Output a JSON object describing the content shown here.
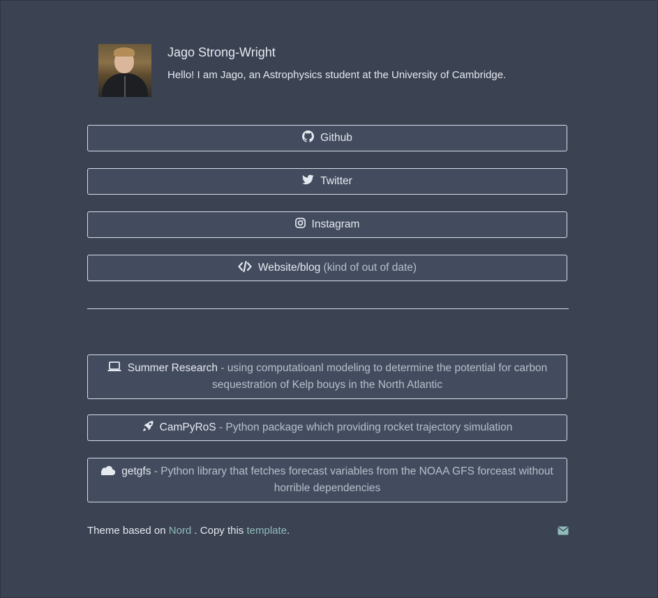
{
  "profile": {
    "name": "Jago Strong-Wright",
    "bio": "Hello! I am Jago, an Astrophysics student at the University of Cambridge.",
    "avatar_icon": "profile-photo"
  },
  "links": [
    {
      "icon": "github-icon",
      "label": "Github",
      "note": ""
    },
    {
      "icon": "twitter-icon",
      "label": "Twitter",
      "note": ""
    },
    {
      "icon": "instagram-icon",
      "label": "Instagram",
      "note": ""
    },
    {
      "icon": "code-icon",
      "label": "Website/blog",
      "note": "(kind of out of date)"
    }
  ],
  "projects": [
    {
      "icon": "laptop-icon",
      "label": "Summer Research",
      "desc": " - using computatioanl modeling to determine the potential for carbon sequestration of Kelp bouys in the North Atlantic"
    },
    {
      "icon": "rocket-icon",
      "label": "CamPyRoS",
      "desc": " - Python package which providing rocket trajectory simulation"
    },
    {
      "icon": "cloud-icon",
      "label": "getgfs",
      "desc": " - Python library that fetches forecast variables from the NOAA GFS forceast without horrible dependencies"
    }
  ],
  "footer": {
    "prefix": "Theme based on ",
    "nord_link": "Nord",
    "middle": " . Copy this ",
    "template_link": "template",
    "suffix": ".",
    "mail_icon": "envelope-icon"
  },
  "colors": {
    "background": "#3b4252",
    "button_bg": "#434c5e",
    "border": "#d8dee9",
    "text": "#e5e9f0",
    "muted": "#b7bfcc",
    "link": "#8fbcbb"
  }
}
